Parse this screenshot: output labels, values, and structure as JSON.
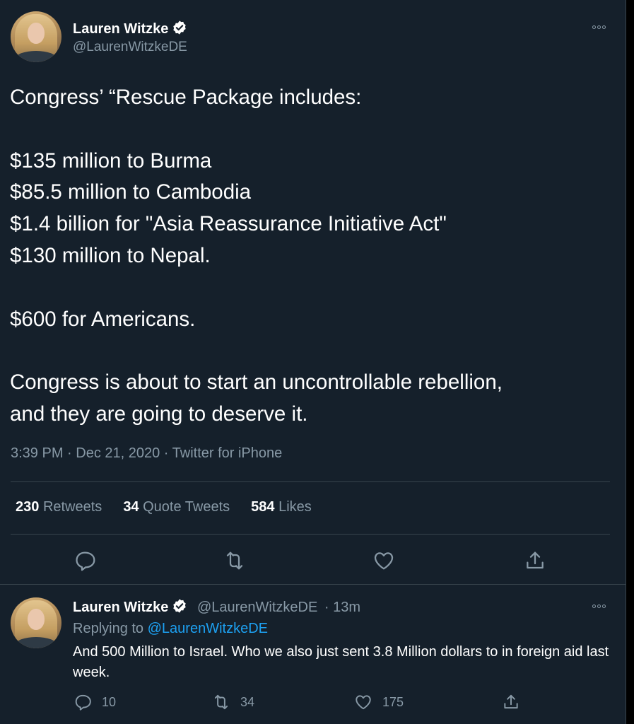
{
  "tweet": {
    "author_name": "Lauren Witzke",
    "author_handle": "@LaurenWitzkeDE",
    "text": "Congress’ “Rescue Package includes:\n\n$135 million to Burma\n$85.5 million to Cambodia\n$1.4 billion for \"Asia Reassurance Initiative Act\"\n$130 million to Nepal.\n\n$600 for Americans.\n\nCongress is about to start an uncontrollable rebellion,\nand they are going to deserve it.",
    "timestamp": "3:39 PM · Dec 21, 2020 · Twitter for iPhone",
    "retweets_count": "230",
    "retweets_label": "Retweets",
    "quotes_count": "34",
    "quotes_label": "Quote Tweets",
    "likes_count": "584",
    "likes_label": "Likes",
    "actions": [
      "reply-icon",
      "retweet-icon",
      "like-icon",
      "share-icon"
    ]
  },
  "reply": {
    "author_name": "Lauren Witzke",
    "author_handle": "@LaurenWitzkeDE",
    "time": "· 13m",
    "replying_prefix": "Replying to",
    "replying_to": "@LaurenWitzkeDE",
    "text": "And 500 Million to Israel. Who we also just sent 3.8 Million dollars to in foreign aid last week.",
    "reply_count": "10",
    "retweet_count": "34",
    "like_count": "175"
  },
  "colors": {
    "background": "#15202b",
    "text_primary": "#ffffff",
    "text_secondary": "#8899a6",
    "accent": "#1da1f2",
    "divider": "#38444d"
  }
}
